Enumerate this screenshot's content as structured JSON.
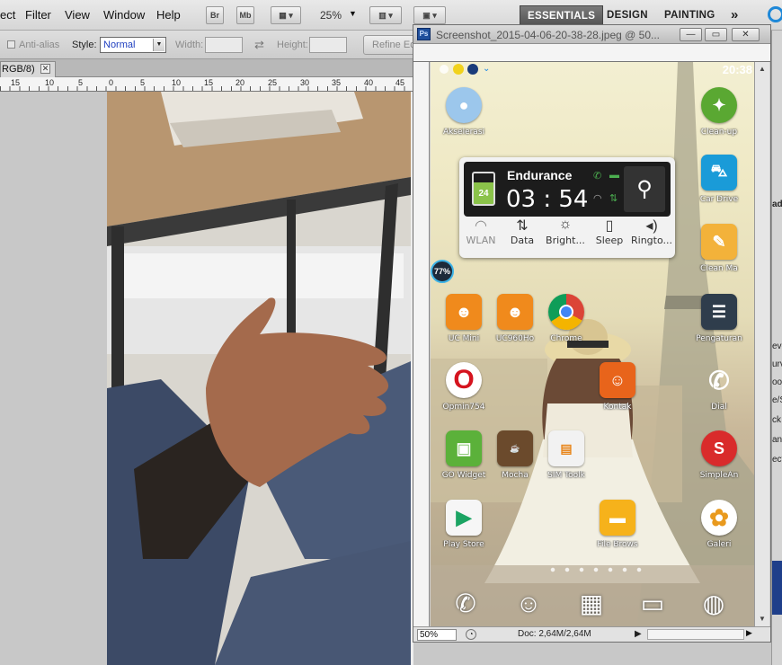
{
  "menubar": {
    "items": [
      "ect",
      "Filter",
      "View",
      "Window",
      "Help"
    ],
    "bridge_label": "Br",
    "minibridge_label": "Mb",
    "zoom_value": "25%",
    "workspaces": [
      "ESSENTIALS",
      "DESIGN",
      "PAINTING"
    ],
    "more_label": "»"
  },
  "options": {
    "antialias_label": "Anti-alias",
    "style_label": "Style:",
    "style_value": "Normal",
    "width_label": "Width:",
    "height_label": "Height:",
    "refine_label": "Refine Edge..."
  },
  "document": {
    "tab_label": "RGB/8)",
    "ruler_labels": [
      "15",
      "10",
      "5",
      "0",
      "5",
      "10",
      "15",
      "20",
      "25",
      "30",
      "35",
      "40",
      "45"
    ]
  },
  "image_window": {
    "title": "Screenshot_2015-04-06-20-38-28.jpeg @ 50...",
    "zoom": "50%",
    "doc_size": "Doc: 2,64M/2,64M"
  },
  "phone": {
    "clock": "20:38",
    "widget": {
      "mode": "Endurance",
      "time": "03 : 54",
      "battery": "24",
      "toggles": [
        "WLAN",
        "Data",
        "Bright...",
        "Sleep",
        "Ringto..."
      ]
    },
    "battery_badge": "77%",
    "apps": [
      {
        "label": "Akselerasi",
        "icon": "accelerate-icon",
        "color": "#7fb2e5"
      },
      {
        "label": "Clean-up",
        "icon": "cleanup-icon",
        "color": "#5aa832"
      },
      {
        "label": "Car Drive",
        "icon": "car-icon",
        "color": "#1a9bd8"
      },
      {
        "label": "Clean Ma",
        "icon": "broom-icon",
        "color": "#f3b23a"
      },
      {
        "label": "UC Mini",
        "icon": "uc-mini-icon",
        "color": "#f08a1c"
      },
      {
        "label": "UC960Ho",
        "icon": "uc-browser-icon",
        "color": "#f08a1c"
      },
      {
        "label": "Chrome",
        "icon": "chrome-icon",
        "color": "#db4437"
      },
      {
        "label": "Pengaturan",
        "icon": "settings-icon",
        "color": "#3a4a5a"
      },
      {
        "label": "Opmin754",
        "icon": "opera-icon",
        "color": "#d5141f"
      },
      {
        "label": "Kontak",
        "icon": "contact-icon",
        "color": "#e8641b"
      },
      {
        "label": "Dial",
        "icon": "phone-icon",
        "color": "#c8c8c8"
      },
      {
        "label": "GO Widget",
        "icon": "go-widget-icon",
        "color": "#5bb13a"
      },
      {
        "label": "Mocha",
        "icon": "mocha-icon",
        "color": "#6b4a2c"
      },
      {
        "label": "SIM Toolk",
        "icon": "sim-icon",
        "color": "#f2f2f2"
      },
      {
        "label": "SimpleAn",
        "icon": "simple-icon",
        "color": "#d92b2b"
      },
      {
        "label": "Play Store",
        "icon": "play-store-icon",
        "color": "#ffffff"
      },
      {
        "label": "File Brows",
        "icon": "folder-icon",
        "color": "#f6b21b"
      },
      {
        "label": "Galeri",
        "icon": "gallery-icon",
        "color": "#e99a1e"
      }
    ],
    "dock": [
      "phone-dock-icon",
      "contacts-dock-icon",
      "apps-grid-icon",
      "message-dock-icon",
      "browser-dock-icon"
    ]
  },
  "rightpanel": {
    "labels": [
      "adj",
      "evels",
      "urve",
      "oos",
      "e/S",
      "ck",
      "ann",
      "ecti"
    ]
  }
}
